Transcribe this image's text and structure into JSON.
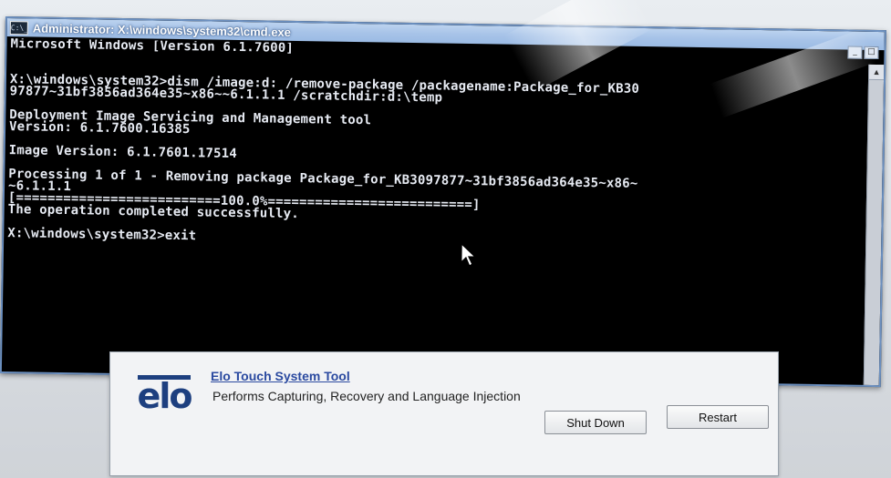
{
  "window": {
    "title": "Administrator: X:\\windows\\system32\\cmd.exe",
    "icon_label": "C:\\_",
    "controls": [
      "minimize",
      "maximize",
      "close"
    ]
  },
  "console": {
    "lines": [
      "Microsoft Windows [Version 6.1.7600]",
      "",
      "",
      "X:\\windows\\system32>dism /image:d: /remove-package /packagename:Package_for_KB30",
      "97877~31bf3856ad364e35~x86~~6.1.1.1 /scratchdir:d:\\temp",
      "",
      "Deployment Image Servicing and Management tool",
      "Version: 6.1.7600.16385",
      "",
      "Image Version: 6.1.7601.17514",
      "",
      "Processing 1 of 1 - Removing package Package_for_KB3097877~31bf3856ad364e35~x86~",
      "~6.1.1.1",
      "[==========================100.0%==========================]",
      "The operation completed successfully.",
      "",
      "X:\\windows\\system32>exit"
    ]
  },
  "elo_tool": {
    "logo_text": "elo",
    "title": "Elo Touch System Tool",
    "description": "Performs Capturing, Recovery and Language Injection",
    "shutdown_label": "Shut Down",
    "restart_label": "Restart"
  },
  "icons": {
    "cmd": "console-icon",
    "pointer": "mouse-pointer-icon",
    "logo": "elo-logo-icon"
  },
  "colors": {
    "console_bg": "#000000",
    "console_text": "#e6eaf2",
    "titlebar": "#a7c3e8",
    "elo_blue": "#1d3f7f",
    "link_blue": "#2b4aa0"
  }
}
